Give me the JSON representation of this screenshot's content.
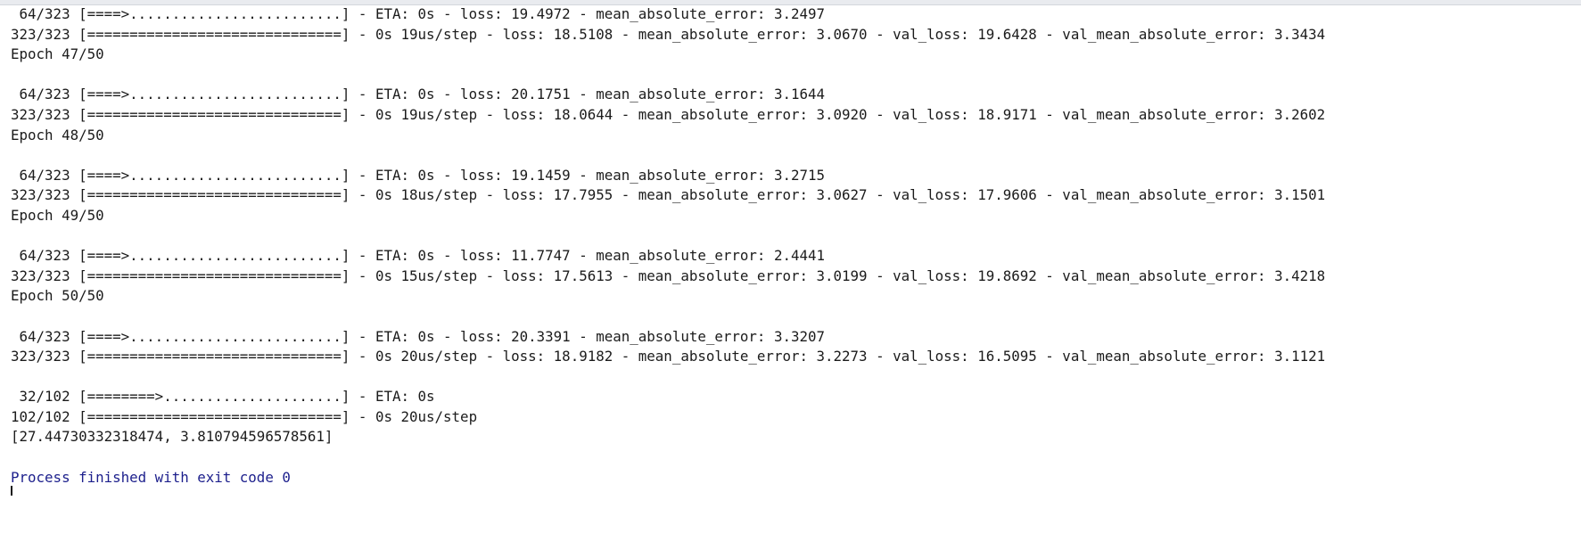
{
  "console": {
    "lines": [
      " 64/323 [====>.........................] - ETA: 0s - loss: 19.4972 - mean_absolute_error: 3.2497",
      "323/323 [==============================] - 0s 19us/step - loss: 18.5108 - mean_absolute_error: 3.0670 - val_loss: 19.6428 - val_mean_absolute_error: 3.3434",
      "Epoch 47/50",
      "",
      " 64/323 [====>.........................] - ETA: 0s - loss: 20.1751 - mean_absolute_error: 3.1644",
      "323/323 [==============================] - 0s 19us/step - loss: 18.0644 - mean_absolute_error: 3.0920 - val_loss: 18.9171 - val_mean_absolute_error: 3.2602",
      "Epoch 48/50",
      "",
      " 64/323 [====>.........................] - ETA: 0s - loss: 19.1459 - mean_absolute_error: 3.2715",
      "323/323 [==============================] - 0s 18us/step - loss: 17.7955 - mean_absolute_error: 3.0627 - val_loss: 17.9606 - val_mean_absolute_error: 3.1501",
      "Epoch 49/50",
      "",
      " 64/323 [====>.........................] - ETA: 0s - loss: 11.7747 - mean_absolute_error: 2.4441",
      "323/323 [==============================] - 0s 15us/step - loss: 17.5613 - mean_absolute_error: 3.0199 - val_loss: 19.8692 - val_mean_absolute_error: 3.4218",
      "Epoch 50/50",
      "",
      " 64/323 [====>.........................] - ETA: 0s - loss: 20.3391 - mean_absolute_error: 3.3207",
      "323/323 [==============================] - 0s 20us/step - loss: 18.9182 - mean_absolute_error: 3.2273 - val_loss: 16.5095 - val_mean_absolute_error: 3.1121",
      "",
      " 32/102 [========>.....................] - ETA: 0s",
      "102/102 [==============================] - 0s 20us/step",
      "[27.44730332318474, 3.810794596578561]",
      "",
      "Process finished with exit code 0"
    ]
  },
  "colors": {
    "background": "#ffffff",
    "text": "#1b1b1b",
    "exit_message": "#1c1f8c"
  }
}
